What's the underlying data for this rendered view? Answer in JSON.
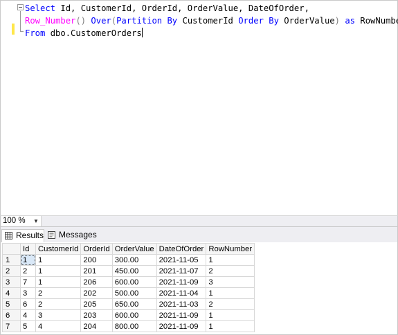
{
  "editor": {
    "line1": {
      "kw_select": "Select",
      "cols": " Id, CustomerId, OrderId, OrderValue, DateOfOrder,"
    },
    "line2": {
      "fn": "Row_Number",
      "p1": "() ",
      "over": "Over",
      "p2": "(",
      "partition": "Partition By",
      "col1": " CustomerId ",
      "orderby": "Order By",
      "col2": " OrderValue",
      "p3": ") ",
      "as": "as",
      "alias": " RowNumber"
    },
    "line3": {
      "from": "From",
      "table": " dbo.CustomerOrders"
    }
  },
  "zoom": {
    "value": "100 %"
  },
  "tabs": [
    {
      "label": "Results",
      "icon": "grid-icon",
      "active": true
    },
    {
      "label": "Messages",
      "icon": "messages-icon",
      "active": false
    }
  ],
  "grid": {
    "columns": [
      "Id",
      "CustomerId",
      "OrderId",
      "OrderValue",
      "DateOfOrder",
      "RowNumber"
    ],
    "rows": [
      {
        "n": "1",
        "cells": [
          "1",
          "1",
          "200",
          "300.00",
          "2021-11-05",
          "1"
        ]
      },
      {
        "n": "2",
        "cells": [
          "2",
          "1",
          "201",
          "450.00",
          "2021-11-07",
          "2"
        ]
      },
      {
        "n": "3",
        "cells": [
          "7",
          "1",
          "206",
          "600.00",
          "2021-11-09",
          "3"
        ]
      },
      {
        "n": "4",
        "cells": [
          "3",
          "2",
          "202",
          "500.00",
          "2021-11-04",
          "1"
        ]
      },
      {
        "n": "5",
        "cells": [
          "6",
          "2",
          "205",
          "650.00",
          "2021-11-03",
          "2"
        ]
      },
      {
        "n": "6",
        "cells": [
          "4",
          "3",
          "203",
          "600.00",
          "2021-11-09",
          "1"
        ]
      },
      {
        "n": "7",
        "cells": [
          "5",
          "4",
          "204",
          "800.00",
          "2021-11-09",
          "1"
        ]
      }
    ]
  }
}
